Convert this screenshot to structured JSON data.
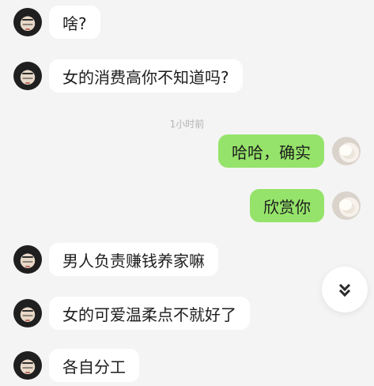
{
  "chat": {
    "messages": [
      {
        "side": "incoming",
        "text": "啥?"
      },
      {
        "side": "incoming",
        "text": "女的消费高你不知道吗?"
      },
      {
        "side": "system",
        "text": "1小时前"
      },
      {
        "side": "outgoing",
        "text": "哈哈，确实"
      },
      {
        "side": "outgoing",
        "text": "欣赏你"
      },
      {
        "side": "incoming",
        "text": "男人负责赚钱养家嘛"
      },
      {
        "side": "incoming",
        "text": "女的可爱温柔点不就好了"
      },
      {
        "side": "incoming",
        "text": "各自分工"
      }
    ]
  },
  "scroll_button": {
    "icon": "double-chevron-down-icon"
  }
}
